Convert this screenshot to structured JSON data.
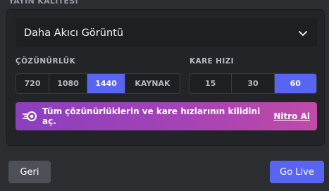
{
  "section_title": "YAYIN KALİTESİ",
  "preset_select": {
    "value": "Daha Akıcı Görüntü"
  },
  "resolution": {
    "label": "ÇÖZÜNÜRLÜK",
    "options": [
      "720",
      "1080",
      "1440",
      "KAYNAK"
    ],
    "selected": "1440"
  },
  "framerate": {
    "label": "KARE HIZI",
    "options": [
      "15",
      "30",
      "60"
    ],
    "selected": "60"
  },
  "nitro_banner": {
    "text": "Tüm çözünürlüklerin ve kare hızlarının kilidini aç.",
    "link": "Nitro Al",
    "icon": "nitro-icon"
  },
  "footer": {
    "back_label": "Geri",
    "go_live_label": "Go Live"
  },
  "colors": {
    "accent": "#5865f2",
    "background": "#2b2d31",
    "panel": "#232428",
    "nitro_gradient_start": "#8b3fbd",
    "nitro_gradient_end": "#c04aa7"
  }
}
